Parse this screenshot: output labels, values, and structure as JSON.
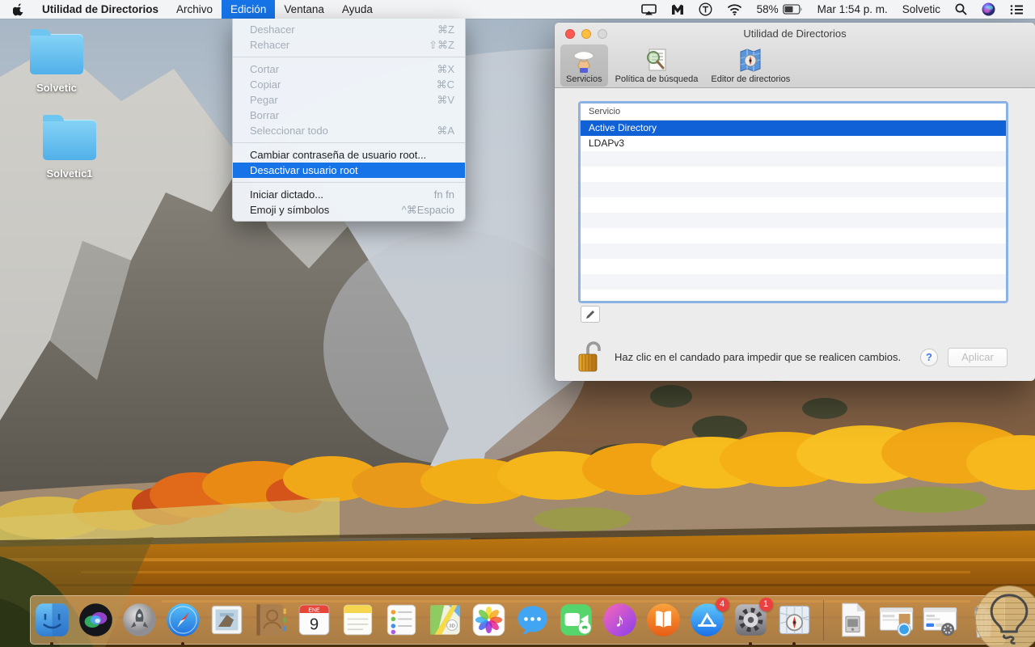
{
  "menu_bar": {
    "items": [
      {
        "label": "Utilidad de Directorios",
        "bold": true
      },
      {
        "label": "Archivo"
      },
      {
        "label": "Edición",
        "active": true
      },
      {
        "label": "Ventana"
      },
      {
        "label": "Ayuda"
      }
    ],
    "status": {
      "battery": "58%",
      "clock": "Mar 1:54 p. m.",
      "user": "Solvetic"
    }
  },
  "edit_menu": {
    "items": [
      {
        "label": "Deshacer",
        "shortcut": "⌘Z",
        "state": "disabled"
      },
      {
        "label": "Rehacer",
        "shortcut": "⇧⌘Z",
        "state": "disabled"
      },
      {
        "type": "separator"
      },
      {
        "label": "Cortar",
        "shortcut": "⌘X",
        "state": "disabled"
      },
      {
        "label": "Copiar",
        "shortcut": "⌘C",
        "state": "disabled"
      },
      {
        "label": "Pegar",
        "shortcut": "⌘V",
        "state": "disabled"
      },
      {
        "label": "Borrar",
        "shortcut": "",
        "state": "disabled"
      },
      {
        "label": "Seleccionar todo",
        "shortcut": "⌘A",
        "state": "disabled"
      },
      {
        "type": "separator"
      },
      {
        "label": "Cambiar contraseña de usuario root...",
        "shortcut": "",
        "state": "enabled"
      },
      {
        "label": "Desactivar usuario root",
        "shortcut": "",
        "state": "selected"
      },
      {
        "type": "separator"
      },
      {
        "label": "Iniciar dictado...",
        "shortcut": "fn fn",
        "state": "enabled"
      },
      {
        "label": "Emoji y símbolos",
        "shortcut": "^⌘Espacio",
        "state": "enabled"
      }
    ]
  },
  "desktop": {
    "folders": [
      {
        "name": "Solvetic"
      },
      {
        "name": "Solvetic1"
      }
    ]
  },
  "window": {
    "title": "Utilidad de Directorios",
    "toolbar": [
      {
        "label": "Servicios",
        "icon": "services-icon",
        "selected": true
      },
      {
        "label": "Política de búsqueda",
        "icon": "search-policy-icon",
        "selected": false
      },
      {
        "label": "Editor de directorios",
        "icon": "directory-editor-icon",
        "selected": false
      }
    ],
    "table": {
      "header": "Servicio",
      "rows": [
        {
          "name": "Active Directory",
          "selected": true
        },
        {
          "name": "LDAPv3",
          "selected": false
        }
      ],
      "empty_rows": 10
    },
    "lock_text": "Haz clic en el candado para impedir que se realicen cambios.",
    "help_label": "?",
    "apply_label": "Aplicar"
  },
  "dock": {
    "items": [
      {
        "icon": "finder",
        "running": true
      },
      {
        "icon": "siri"
      },
      {
        "icon": "launchpad"
      },
      {
        "icon": "safari",
        "running": true
      },
      {
        "icon": "mail"
      },
      {
        "icon": "contacts"
      },
      {
        "icon": "calendar",
        "month": "ENE",
        "day": "9"
      },
      {
        "icon": "notes"
      },
      {
        "icon": "reminders"
      },
      {
        "icon": "maps"
      },
      {
        "icon": "photos"
      },
      {
        "icon": "messages"
      },
      {
        "icon": "facetime"
      },
      {
        "icon": "itunes"
      },
      {
        "icon": "ibooks"
      },
      {
        "icon": "appstore",
        "badge": "4"
      },
      {
        "icon": "sysprefs",
        "badge": "1",
        "running": true
      },
      {
        "icon": "dirutil",
        "running": true
      },
      {
        "type": "divider"
      },
      {
        "icon": "docfile"
      },
      {
        "icon": "window-safari"
      },
      {
        "icon": "window-prefs"
      },
      {
        "icon": "trash"
      }
    ]
  },
  "colors": {
    "menu_highlight": "#1674e8",
    "table_selection": "#1161d6",
    "badge_red": "#ec4040"
  }
}
